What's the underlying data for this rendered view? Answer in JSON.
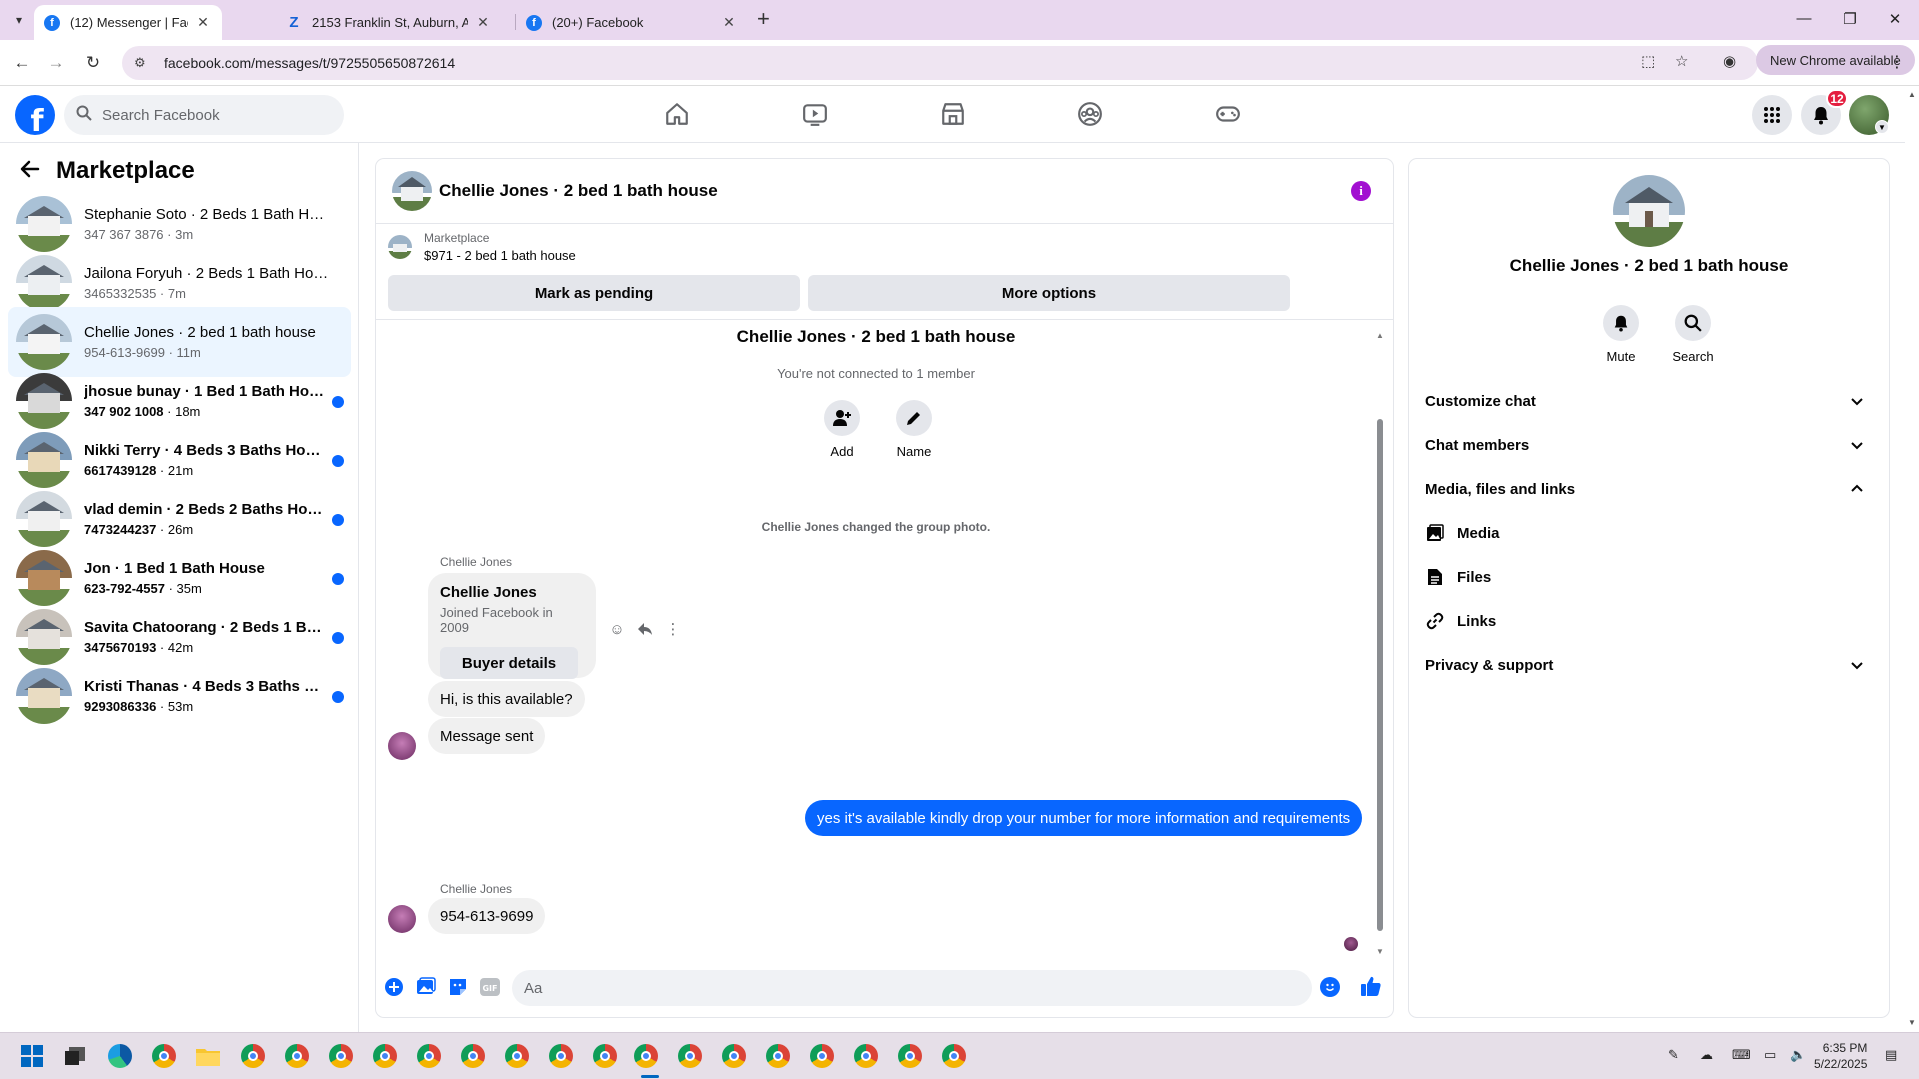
{
  "browser": {
    "tabs": [
      {
        "title": "(12) Messenger | Facebook",
        "favicon": "facebook-icon"
      },
      {
        "title": "2153 Franklin St, Auburn, AL 36",
        "favicon": "zillow-icon"
      },
      {
        "title": "(20+) Facebook",
        "favicon": "facebook-icon"
      }
    ],
    "url": "facebook.com/messages/t/9725505650872614",
    "new_chrome_label": "New Chrome available"
  },
  "fb_header": {
    "search_placeholder": "Search Facebook",
    "notification_count": "12",
    "brand_color": "#0866ff"
  },
  "left_panel": {
    "title": "Marketplace",
    "conversations": [
      {
        "name": "Stephanie Soto · 2 Beds 1 Bath Ho...",
        "phone": "347 367 3876",
        "time": "3m",
        "unread": false
      },
      {
        "name": "Jailona Foryuh · 2 Beds 1 Bath Hou...",
        "phone": "3465332535",
        "time": "7m",
        "unread": false
      },
      {
        "name": "Chellie Jones · 2 bed 1 bath house",
        "phone": "954-613-9699",
        "time": "11m",
        "unread": false,
        "selected": true
      },
      {
        "name": "jhosue bunay · 1 Bed 1 Bath House",
        "phone": "347 902 1008",
        "time": "18m",
        "unread": true
      },
      {
        "name": "Nikki Terry · 4 Beds 3 Baths House",
        "phone": "6617439128",
        "time": "21m",
        "unread": true
      },
      {
        "name": "vlad demin · 2 Beds 2 Baths House",
        "phone": "7473244237",
        "time": "26m",
        "unread": true
      },
      {
        "name": "Jon · 1 Bed 1 Bath House",
        "phone": "623-792-4557",
        "time": "35m",
        "unread": true
      },
      {
        "name": "Savita Chatoorang · 2 Beds 1 Bat...",
        "phone": "3475670193",
        "time": "42m",
        "unread": true
      },
      {
        "name": "Kristi Thanas · 4 Beds 3 Baths Ho...",
        "phone": "9293086336",
        "time": "53m",
        "unread": true
      }
    ]
  },
  "chat": {
    "title": "Chellie Jones · 2 bed 1 bath house",
    "marketplace_label": "Marketplace",
    "listing": "$971 - 2 bed 1 bath house",
    "mark_pending": "Mark as pending",
    "more_options": "More options",
    "thread_title": "Chellie Jones · 2 bed 1 bath house",
    "not_connected": "You're not connected to 1 member",
    "add_label": "Add",
    "name_label": "Name",
    "system_message": "Chellie Jones changed the group photo.",
    "sender": "Chellie Jones",
    "card": {
      "name": "Chellie Jones",
      "joined": "Joined Facebook in 2009",
      "button": "Buyer details"
    },
    "messages": [
      {
        "from": "them",
        "text": "Hi, is this available?"
      },
      {
        "from": "them",
        "text": "Message sent"
      },
      {
        "from": "me",
        "text": "yes it's available kindly drop your number for more information and requirements"
      },
      {
        "from": "them",
        "text": "954-613-9699"
      }
    ],
    "composer_placeholder": "Aa"
  },
  "right_panel": {
    "name": "Chellie Jones · 2 bed 1 bath house",
    "mute_label": "Mute",
    "search_label": "Search",
    "sections": {
      "customize": "Customize chat",
      "members": "Chat members",
      "media_files_links": "Media, files and links",
      "media": "Media",
      "files": "Files",
      "links": "Links",
      "privacy": "Privacy & support"
    }
  },
  "taskbar": {
    "time": "6:35 PM",
    "date": "5/22/2025"
  }
}
